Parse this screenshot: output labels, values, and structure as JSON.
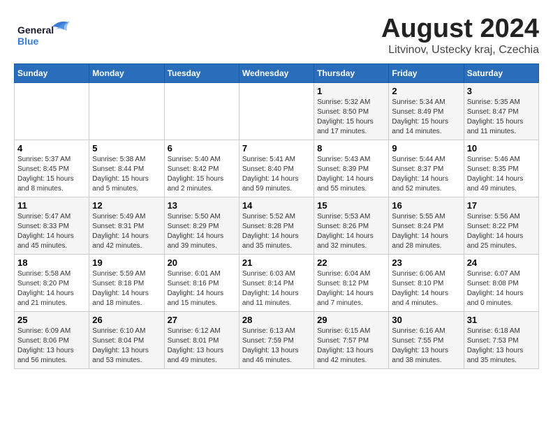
{
  "logo": {
    "line1": "General",
    "line2": "Blue"
  },
  "title": "August 2024",
  "location": "Litvinov, Ustecky kraj, Czechia",
  "weekdays": [
    "Sunday",
    "Monday",
    "Tuesday",
    "Wednesday",
    "Thursday",
    "Friday",
    "Saturday"
  ],
  "weeks": [
    [
      {
        "day": "",
        "info": ""
      },
      {
        "day": "",
        "info": ""
      },
      {
        "day": "",
        "info": ""
      },
      {
        "day": "",
        "info": ""
      },
      {
        "day": "1",
        "info": "Sunrise: 5:32 AM\nSunset: 8:50 PM\nDaylight: 15 hours and 17 minutes."
      },
      {
        "day": "2",
        "info": "Sunrise: 5:34 AM\nSunset: 8:49 PM\nDaylight: 15 hours and 14 minutes."
      },
      {
        "day": "3",
        "info": "Sunrise: 5:35 AM\nSunset: 8:47 PM\nDaylight: 15 hours and 11 minutes."
      }
    ],
    [
      {
        "day": "4",
        "info": "Sunrise: 5:37 AM\nSunset: 8:45 PM\nDaylight: 15 hours and 8 minutes."
      },
      {
        "day": "5",
        "info": "Sunrise: 5:38 AM\nSunset: 8:44 PM\nDaylight: 15 hours and 5 minutes."
      },
      {
        "day": "6",
        "info": "Sunrise: 5:40 AM\nSunset: 8:42 PM\nDaylight: 15 hours and 2 minutes."
      },
      {
        "day": "7",
        "info": "Sunrise: 5:41 AM\nSunset: 8:40 PM\nDaylight: 14 hours and 59 minutes."
      },
      {
        "day": "8",
        "info": "Sunrise: 5:43 AM\nSunset: 8:39 PM\nDaylight: 14 hours and 55 minutes."
      },
      {
        "day": "9",
        "info": "Sunrise: 5:44 AM\nSunset: 8:37 PM\nDaylight: 14 hours and 52 minutes."
      },
      {
        "day": "10",
        "info": "Sunrise: 5:46 AM\nSunset: 8:35 PM\nDaylight: 14 hours and 49 minutes."
      }
    ],
    [
      {
        "day": "11",
        "info": "Sunrise: 5:47 AM\nSunset: 8:33 PM\nDaylight: 14 hours and 45 minutes."
      },
      {
        "day": "12",
        "info": "Sunrise: 5:49 AM\nSunset: 8:31 PM\nDaylight: 14 hours and 42 minutes."
      },
      {
        "day": "13",
        "info": "Sunrise: 5:50 AM\nSunset: 8:29 PM\nDaylight: 14 hours and 39 minutes."
      },
      {
        "day": "14",
        "info": "Sunrise: 5:52 AM\nSunset: 8:28 PM\nDaylight: 14 hours and 35 minutes."
      },
      {
        "day": "15",
        "info": "Sunrise: 5:53 AM\nSunset: 8:26 PM\nDaylight: 14 hours and 32 minutes."
      },
      {
        "day": "16",
        "info": "Sunrise: 5:55 AM\nSunset: 8:24 PM\nDaylight: 14 hours and 28 minutes."
      },
      {
        "day": "17",
        "info": "Sunrise: 5:56 AM\nSunset: 8:22 PM\nDaylight: 14 hours and 25 minutes."
      }
    ],
    [
      {
        "day": "18",
        "info": "Sunrise: 5:58 AM\nSunset: 8:20 PM\nDaylight: 14 hours and 21 minutes."
      },
      {
        "day": "19",
        "info": "Sunrise: 5:59 AM\nSunset: 8:18 PM\nDaylight: 14 hours and 18 minutes."
      },
      {
        "day": "20",
        "info": "Sunrise: 6:01 AM\nSunset: 8:16 PM\nDaylight: 14 hours and 15 minutes."
      },
      {
        "day": "21",
        "info": "Sunrise: 6:03 AM\nSunset: 8:14 PM\nDaylight: 14 hours and 11 minutes."
      },
      {
        "day": "22",
        "info": "Sunrise: 6:04 AM\nSunset: 8:12 PM\nDaylight: 14 hours and 7 minutes."
      },
      {
        "day": "23",
        "info": "Sunrise: 6:06 AM\nSunset: 8:10 PM\nDaylight: 14 hours and 4 minutes."
      },
      {
        "day": "24",
        "info": "Sunrise: 6:07 AM\nSunset: 8:08 PM\nDaylight: 14 hours and 0 minutes."
      }
    ],
    [
      {
        "day": "25",
        "info": "Sunrise: 6:09 AM\nSunset: 8:06 PM\nDaylight: 13 hours and 56 minutes."
      },
      {
        "day": "26",
        "info": "Sunrise: 6:10 AM\nSunset: 8:04 PM\nDaylight: 13 hours and 53 minutes."
      },
      {
        "day": "27",
        "info": "Sunrise: 6:12 AM\nSunset: 8:01 PM\nDaylight: 13 hours and 49 minutes."
      },
      {
        "day": "28",
        "info": "Sunrise: 6:13 AM\nSunset: 7:59 PM\nDaylight: 13 hours and 46 minutes."
      },
      {
        "day": "29",
        "info": "Sunrise: 6:15 AM\nSunset: 7:57 PM\nDaylight: 13 hours and 42 minutes."
      },
      {
        "day": "30",
        "info": "Sunrise: 6:16 AM\nSunset: 7:55 PM\nDaylight: 13 hours and 38 minutes."
      },
      {
        "day": "31",
        "info": "Sunrise: 6:18 AM\nSunset: 7:53 PM\nDaylight: 13 hours and 35 minutes."
      }
    ]
  ]
}
